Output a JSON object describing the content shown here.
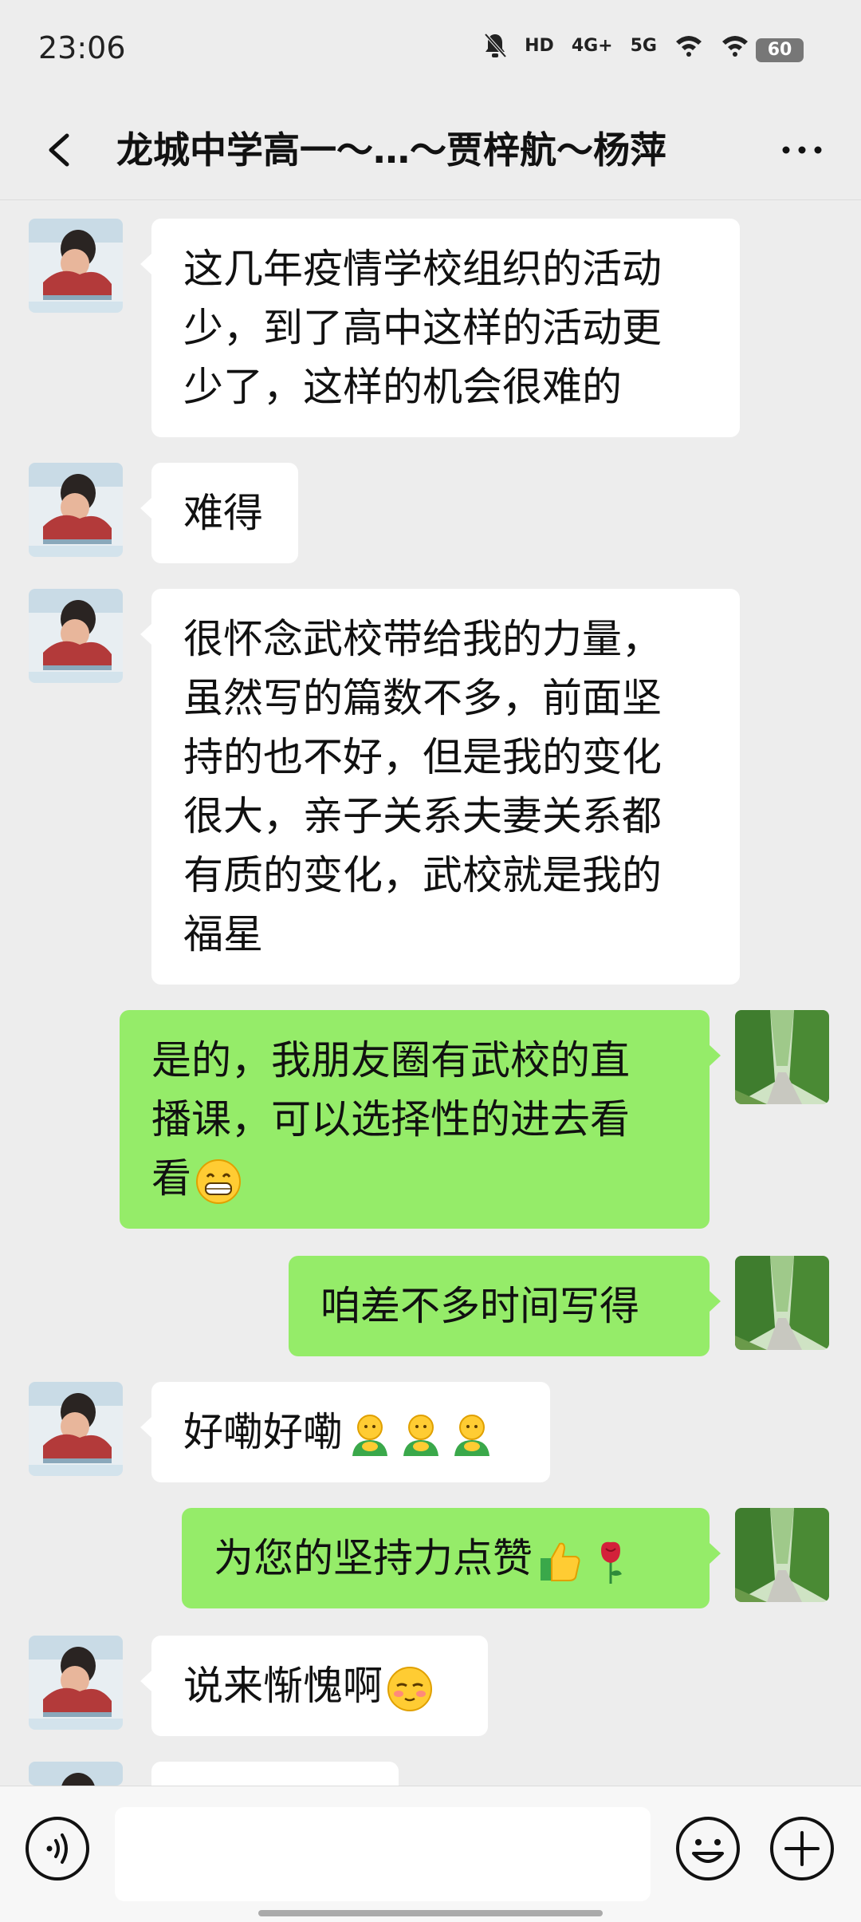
{
  "status_bar": {
    "time": "23:06",
    "icons": [
      "bell-off-icon",
      "hd-icon",
      "signal-4g-icon",
      "signal-5g-icon",
      "wifi-calling-icon",
      "wifi-icon"
    ],
    "hd": "HD",
    "net_4g": "4G+",
    "net_5g": "5G",
    "battery": "60"
  },
  "header": {
    "title": "龙城中学高一～…～贾梓航～杨萍",
    "back_icon": "chevron-left-icon",
    "more_icon": "more-icon"
  },
  "messages": [
    {
      "side": "in",
      "lines": [
        "这几年疫情学校组织的活动",
        "少，到了高中这样的活动更",
        "少了，这样的机会很难的"
      ]
    },
    {
      "side": "in",
      "lines": [
        "难得"
      ]
    },
    {
      "side": "in",
      "lines": [
        "很怀念武校带给我的力量，",
        "虽然写的篇数不多，前面坚",
        "持的也不好，但是我的变化",
        "很大，亲子关系夫妻关系都",
        "有质的变化，武校就是我的",
        "福星"
      ]
    },
    {
      "side": "out",
      "lines": [
        "是的，我朋友圈有武校的直",
        "播课，可以选择性的进去看",
        "看"
      ],
      "emoji": [
        "grin-emoji"
      ]
    },
    {
      "side": "out",
      "lines": [
        "咱差不多时间写得"
      ]
    },
    {
      "side": "in",
      "lines": [
        "好嘞好嘞"
      ],
      "emoji": [
        "bow-emoji",
        "bow-emoji",
        "bow-emoji"
      ]
    },
    {
      "side": "out",
      "lines": [
        "为您的坚持力点赞"
      ],
      "emoji": [
        "thumbs-up-emoji",
        "rose-emoji"
      ]
    },
    {
      "side": "in",
      "lines": [
        "说来惭愧啊"
      ],
      "emoji": [
        "shy-emoji"
      ]
    }
  ],
  "input": {
    "value": "",
    "placeholder": ""
  },
  "colors": {
    "background": "#ededed",
    "incoming_bubble": "#ffffff",
    "outgoing_bubble": "#95ec69"
  }
}
